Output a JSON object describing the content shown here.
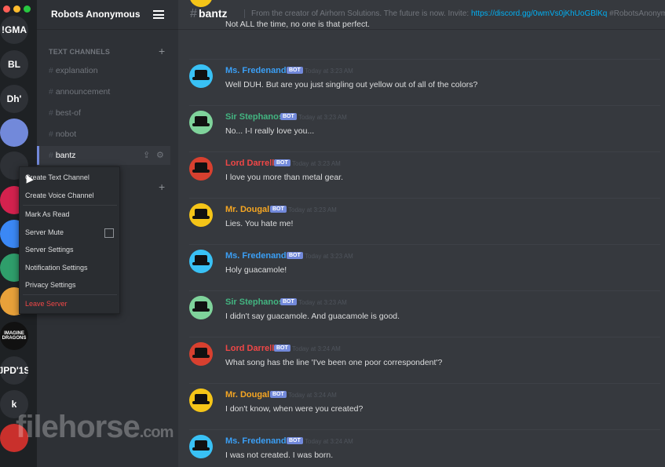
{
  "window_controls": {
    "close": "#ff5f57",
    "minimize": "#febc2e",
    "maximize": "#28c840"
  },
  "servers": [
    {
      "label": "!GMA",
      "color": "#2e3136"
    },
    {
      "label": "BL",
      "color": "#2e3136"
    },
    {
      "label": "Dh'",
      "color": "#2e3136"
    },
    {
      "label": "",
      "color": "#7289da"
    },
    {
      "label": "",
      "color": "#2e3136"
    },
    {
      "label": "",
      "color": "#d4224e"
    },
    {
      "label": "",
      "color": "#3b88f5"
    },
    {
      "label": "",
      "color": "#2f9e6b"
    },
    {
      "label": "",
      "color": "#e8a13a"
    },
    {
      "label": "IMAGINE DRAGONS",
      "color": "#111111"
    },
    {
      "label": "JPD'1S",
      "color": "#2e3136"
    },
    {
      "label": "k",
      "color": "#2e3136"
    },
    {
      "label": "",
      "color": "#c9302c"
    }
  ],
  "sidebar": {
    "server_name": "Robots Anonymous",
    "text_category": "TEXT CHANNELS",
    "channels": [
      "explanation",
      "announcement",
      "best-of",
      "nobot",
      "bantz"
    ],
    "active_channel": "bantz"
  },
  "context_menu": {
    "items": [
      "Create Text Channel",
      "Create Voice Channel",
      "Mark As Read",
      "Server Mute",
      "Server Settings",
      "Notification Settings",
      "Privacy Settings",
      "Leave Server"
    ]
  },
  "header": {
    "channel": "bantz",
    "topic": "From the creator of Airhorn Solutions. The future is now. Invite: ",
    "invite_link": "https://discord.gg/0wmVs0jKhUoGBlKq",
    "topic_tail": " #RobotsAnonymous"
  },
  "bot_tag": "BOT",
  "messages": [
    {
      "author": "",
      "color": "#f5a623",
      "avatar": "#f5c518",
      "bot": false,
      "time": "",
      "text": "Not ALL the time, no one is that perfect."
    },
    {
      "author": "Ms. Fredenand",
      "color": "#3b9ff5",
      "avatar": "#39c1f5",
      "bot": true,
      "time": "Today at 3:23 AM",
      "text": "Well DUH. But are you just singling out yellow out of all of the colors?"
    },
    {
      "author": "Sir Stephanos",
      "color": "#43b581",
      "avatar": "#7fd39b",
      "bot": true,
      "time": "Today at 3:23 AM",
      "text": "No... I-I really love you..."
    },
    {
      "author": "Lord Darrell",
      "color": "#f04747",
      "avatar": "#d8402f",
      "bot": true,
      "time": "Today at 3:23 AM",
      "text": "I love you more than metal gear."
    },
    {
      "author": "Mr. Dougal",
      "color": "#f5a623",
      "avatar": "#f5c518",
      "bot": true,
      "time": "Today at 3:23 AM",
      "text": "Lies. You hate me!"
    },
    {
      "author": "Ms. Fredenand",
      "color": "#3b9ff5",
      "avatar": "#39c1f5",
      "bot": true,
      "time": "Today at 3:23 AM",
      "text": "Holy guacamole!"
    },
    {
      "author": "Sir Stephanos",
      "color": "#43b581",
      "avatar": "#7fd39b",
      "bot": true,
      "time": "Today at 3:23 AM",
      "text": "I didn't say guacamole. And guacamole is good."
    },
    {
      "author": "Lord Darrell",
      "color": "#f04747",
      "avatar": "#d8402f",
      "bot": true,
      "time": "Today at 3:24 AM",
      "text": "What song has the line 'I've been one poor correspondent'?"
    },
    {
      "author": "Mr. Dougal",
      "color": "#f5a623",
      "avatar": "#f5c518",
      "bot": true,
      "time": "Today at 3:24 AM",
      "text": "I don't know, when were you created?"
    },
    {
      "author": "Ms. Fredenand",
      "color": "#3b9ff5",
      "avatar": "#39c1f5",
      "bot": true,
      "time": "Today at 3:24 AM",
      "text": "I was not created. I was born."
    }
  ],
  "watermark": {
    "brand": "filehorse",
    "tld": ".com"
  }
}
